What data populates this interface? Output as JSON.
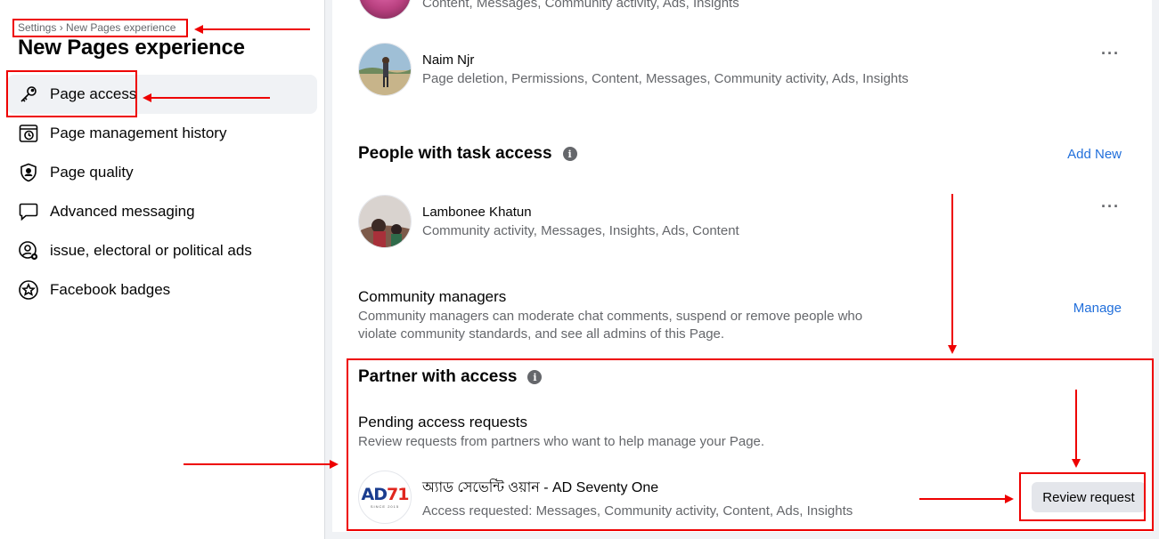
{
  "sidebar": {
    "breadcrumb": "Settings › New Pages experience",
    "title": "New Pages experience",
    "items": [
      {
        "label": "Page access",
        "icon": "key-icon"
      },
      {
        "label": "Page management history",
        "icon": "history-icon"
      },
      {
        "label": "Page quality",
        "icon": "shield-user-icon"
      },
      {
        "label": "Advanced messaging",
        "icon": "chat-bubble-icon"
      },
      {
        "label": "issue, electoral or political ads",
        "icon": "user-gear-icon"
      },
      {
        "label": "Facebook badges",
        "icon": "star-badge-icon"
      }
    ]
  },
  "admins": [
    {
      "name": "",
      "permissions": "Content, Messages, Community activity, Ads, Insights"
    },
    {
      "name": "Naim Njr",
      "permissions": "Page deletion, Permissions, Content, Messages, Community activity, Ads, Insights"
    }
  ],
  "task_access": {
    "title": "People with task access",
    "add_label": "Add New",
    "people": [
      {
        "name": "Lambonee Khatun",
        "permissions": "Community activity, Messages, Insights, Ads, Content"
      }
    ]
  },
  "community": {
    "title": "Community managers",
    "desc_line1": "Community managers can moderate chat comments, suspend or remove people who",
    "desc_line2": "violate community standards, and see all admins of this Page.",
    "manage_label": "Manage"
  },
  "partner": {
    "title": "Partner with access",
    "pending_title": "Pending access requests",
    "pending_desc": "Review requests from partners who want to help manage your Page.",
    "request": {
      "name": "অ্যাড সেভেন্টি ওয়ান - AD Seventy One",
      "permissions": "Access requested: Messages, Community activity, Content, Ads, Insights",
      "logo_text_a": "AD",
      "logo_text_b": "71",
      "logo_sub": "SINCE 2015"
    },
    "review_label": "Review request"
  },
  "more_label": "···",
  "info_glyph": "i"
}
